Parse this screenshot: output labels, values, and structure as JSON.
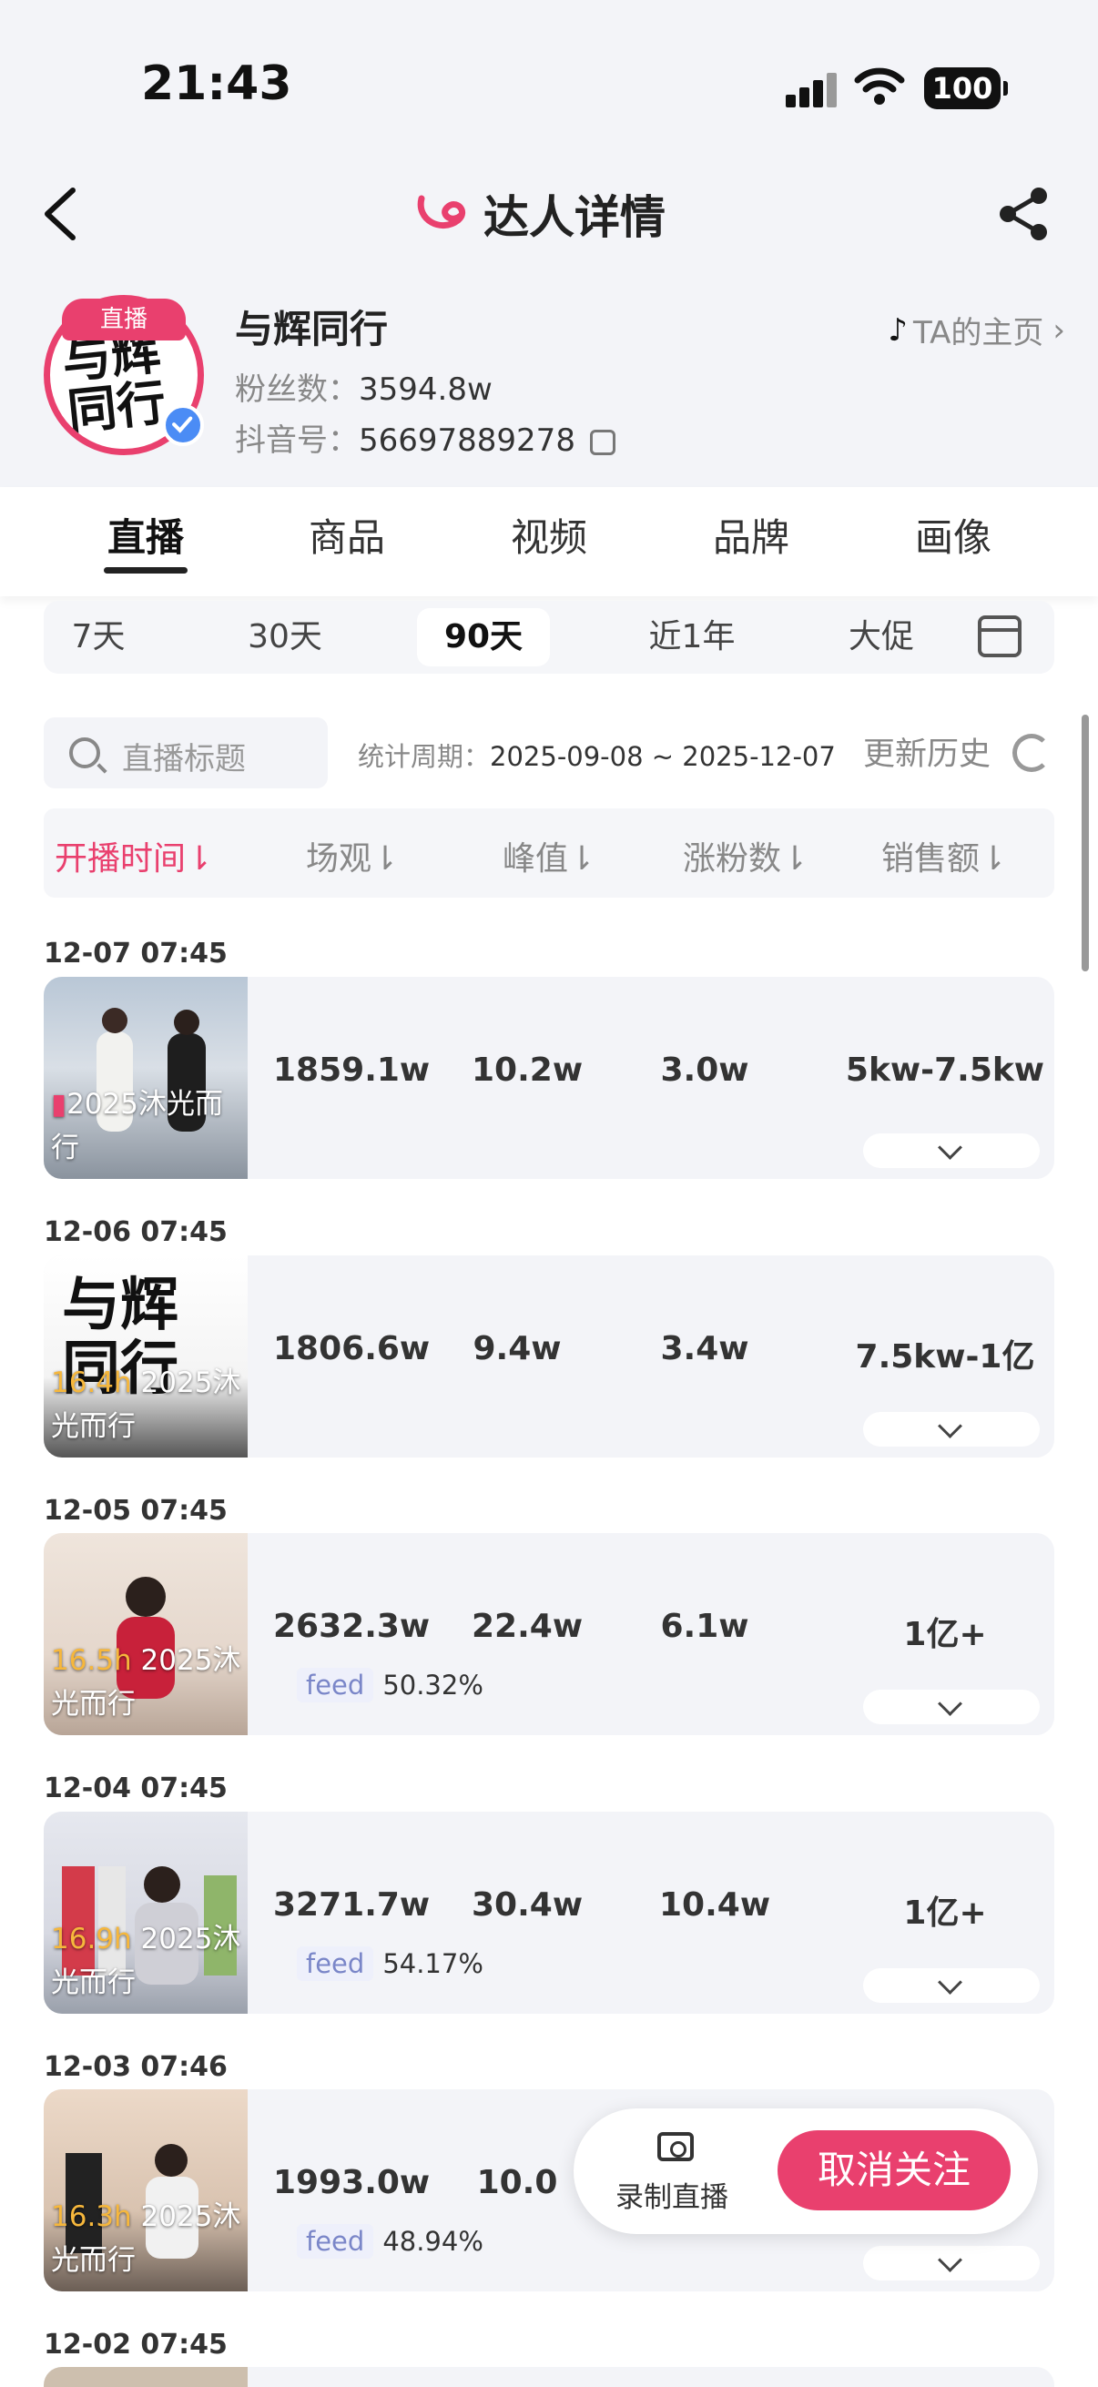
{
  "status": {
    "time": "21:43",
    "battery": "100"
  },
  "nav": {
    "title": "达人详情"
  },
  "profile": {
    "name": "与辉同行",
    "live_badge": "直播",
    "fans_label": "粉丝数：",
    "fans_value": "3594.8w",
    "douyin_label": "抖音号：",
    "douyin_value": "56697889278",
    "home_link": "TA的主页",
    "avatar_text": "与辉同行"
  },
  "tabs": [
    "直播",
    "商品",
    "视频",
    "品牌",
    "画像"
  ],
  "periods": [
    "7天",
    "30天",
    "90天",
    "近1年",
    "大促"
  ],
  "selected_period": "90天",
  "search": {
    "placeholder": "直播标题"
  },
  "stat": {
    "label": "统计周期：",
    "range": "2025-09-08 ~ 2025-12-07"
  },
  "history_label": "更新历史",
  "table_headers": [
    "开播时间⇂",
    "场观⇂",
    "峰值⇂",
    "涨粉数⇂",
    "销售额⇂"
  ],
  "rows": [
    {
      "date": "12-07 07:45",
      "duration": "",
      "title": "2025沐光而行",
      "views": "1859.1w",
      "peak": "10.2w",
      "fans": "3.0w",
      "sales": "5kw-7.5kw",
      "feed": ""
    },
    {
      "date": "12-06 07:45",
      "duration": "16.4h",
      "title": "2025沐光而行",
      "views": "1806.6w",
      "peak": "9.4w",
      "fans": "3.4w",
      "sales": "7.5kw-1亿",
      "feed": ""
    },
    {
      "date": "12-05 07:45",
      "duration": "16.5h",
      "title": "2025沐光而行",
      "views": "2632.3w",
      "peak": "22.4w",
      "fans": "6.1w",
      "sales": "1亿+",
      "feed": "50.32%"
    },
    {
      "date": "12-04 07:45",
      "duration": "16.9h",
      "title": "2025沐光而行",
      "views": "3271.7w",
      "peak": "30.4w",
      "fans": "10.4w",
      "sales": "1亿+",
      "feed": "54.17%"
    },
    {
      "date": "12-03 07:46",
      "duration": "16.3h",
      "title": "2025沐光而行",
      "views": "1993.0w",
      "peak": "10.0",
      "fans": "",
      "sales": "",
      "feed": "48.94%"
    }
  ],
  "next_date": "12-02 07:45",
  "feed_tag": "feed",
  "float": {
    "record_label": "录制直播",
    "unfollow_label": "取消关注"
  },
  "colors": {
    "accent": "#e9406e",
    "background": "#f3f4f8"
  }
}
